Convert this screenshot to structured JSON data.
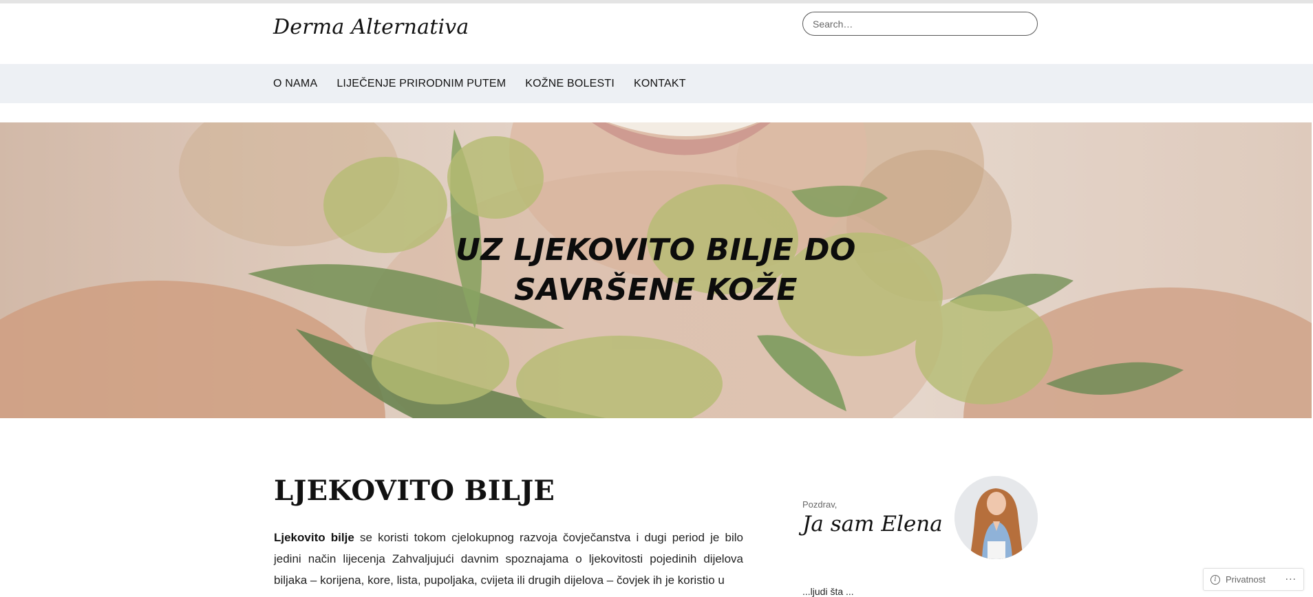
{
  "header": {
    "site_title": "Derma Alternativa",
    "search_placeholder": "Search…"
  },
  "nav": {
    "items": [
      {
        "label": "O NAMA"
      },
      {
        "label": "LIJEČENJE PRIRODNIM PUTEM"
      },
      {
        "label": "KOŽNE BOLESTI"
      },
      {
        "label": "KONTAKT"
      }
    ]
  },
  "hero": {
    "line1": "UZ LJEKOVITO BILJE DO",
    "line2": "SAVRŠENE KOŽE"
  },
  "article": {
    "title": "LJEKOVITO BILJE",
    "lead_bold": "Ljekovito bilje",
    "body": " se koristi tokom cjelokupnog razvoja čovječanstva i dugi period je bilo jedini način lijecenja Zahvaljujući davnim spoznajama o ljekovitosti pojedinih dijelova biljaka – korijena, kore, lista, pupoljaka, cvijeta ili drugih dijelova – čovjek ih je koristio u"
  },
  "sidebar": {
    "greeting": "Pozdrav,",
    "name_heading": "Ja sam Elena",
    "text_fragment": "...ljudi šta ..."
  },
  "privacy_badge": {
    "label": "Privatnost",
    "more": "···"
  },
  "colors": {
    "navbar_bg": "#edf0f4",
    "hero_overlay": "#e4d5cb"
  }
}
